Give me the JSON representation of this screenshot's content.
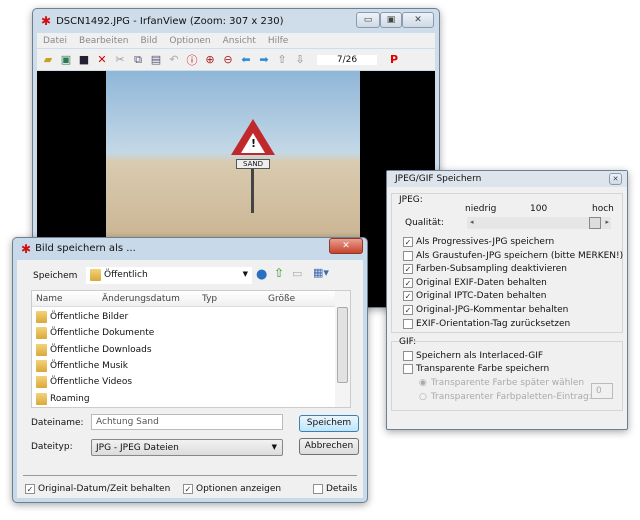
{
  "irfan": {
    "title": "DSCN1492.JPG - IrfanView (Zoom: 307 x 230)",
    "menu": [
      "Datei",
      "Bearbeiten",
      "Bild",
      "Optionen",
      "Ansicht",
      "Hilfe"
    ],
    "page": "7/26",
    "sign_text": "SAND"
  },
  "jpeg": {
    "title": "JPEG/GIF Speichern",
    "jpeg_label": "JPEG:",
    "low": "niedrig",
    "value": "100",
    "high": "hoch",
    "quality_label": "Qualität:",
    "quality_value": 100,
    "options": [
      {
        "label": "Als Progressives-JPG speichern",
        "checked": true
      },
      {
        "label": "Als Graustufen-JPG speichern (bitte MERKEN!)",
        "checked": false
      },
      {
        "label": "Farben-Subsampling deaktivieren",
        "checked": true
      },
      {
        "label": "Original EXIF-Daten behalten",
        "checked": true
      },
      {
        "label": "Original IPTC-Daten behalten",
        "checked": true
      },
      {
        "label": "Original-JPG-Kommentar behalten",
        "checked": true
      },
      {
        "label": "EXIF-Orientation-Tag zurücksetzen",
        "checked": false
      }
    ],
    "gif_label": "GIF:",
    "gif_options": [
      {
        "label": "Speichern als Interlaced-GIF",
        "checked": false
      },
      {
        "label": "Transparente Farbe speichern",
        "checked": false
      }
    ],
    "radio1": "Transparente Farbe später wählen",
    "radio2": "Transparenter Farbpaletten-Eintrag:",
    "palette_value": "0"
  },
  "save": {
    "title": "Bild speichern als ...",
    "location_label": "Speichem",
    "location": "Öffentlich",
    "columns": [
      "Name",
      "Änderungsdatum",
      "Typ",
      "Größe"
    ],
    "files": [
      "Öffentliche Bilder",
      "Öffentliche Dokumente",
      "Öffentliche Downloads",
      "Öffentliche Musik",
      "Öffentliche Videos",
      "Roaming"
    ],
    "filename_label": "Dateiname:",
    "filename": "Achtung Sand",
    "filetype_label": "Dateityp:",
    "filetype": "JPG - JPEG Dateien",
    "save_button": "Speichem",
    "cancel_button": "Abbrechen",
    "keep_date": "Original-Datum/Zeit behalten",
    "show_options": "Optionen anzeigen",
    "details": "Details"
  }
}
